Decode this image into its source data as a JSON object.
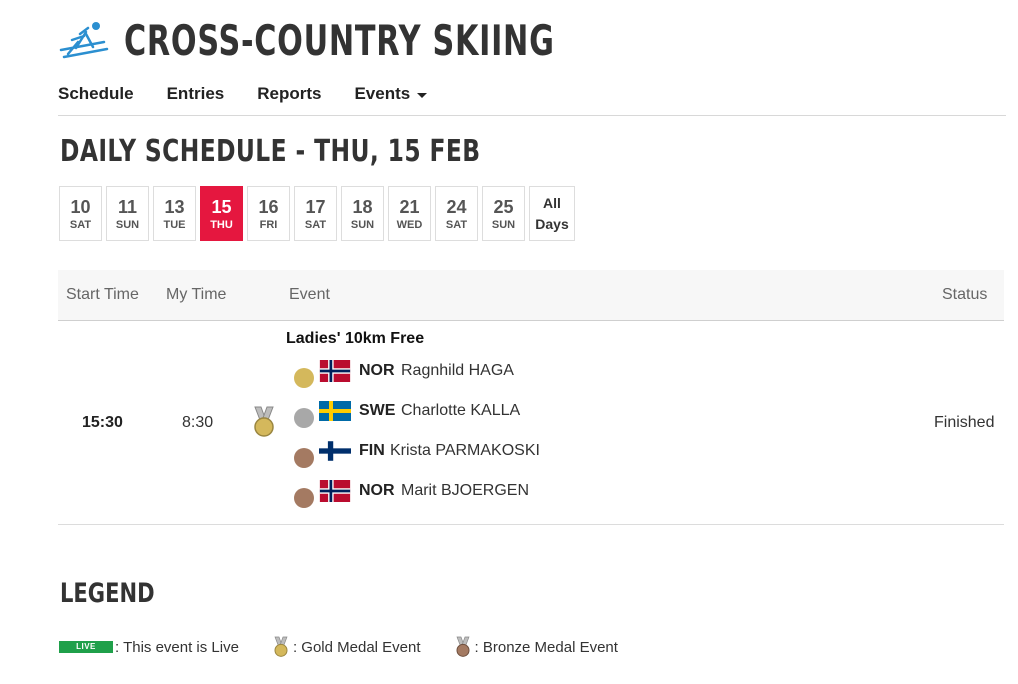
{
  "header": {
    "sport_title": "CROSS-COUNTRY SKIING",
    "logo_icon": "cross-country-skier-icon",
    "accent_color": "#e5173f"
  },
  "nav": {
    "items": [
      {
        "label": "Schedule"
      },
      {
        "label": "Entries"
      },
      {
        "label": "Reports"
      },
      {
        "label": "Events",
        "has_dropdown": true
      }
    ]
  },
  "page_title": "DAILY SCHEDULE - THU, 15 FEB",
  "days": [
    {
      "num": "10",
      "dow": "SAT",
      "active": false
    },
    {
      "num": "11",
      "dow": "SUN",
      "active": false
    },
    {
      "num": "13",
      "dow": "TUE",
      "active": false
    },
    {
      "num": "15",
      "dow": "THU",
      "active": true
    },
    {
      "num": "16",
      "dow": "FRI",
      "active": false
    },
    {
      "num": "17",
      "dow": "SAT",
      "active": false
    },
    {
      "num": "18",
      "dow": "SUN",
      "active": false
    },
    {
      "num": "21",
      "dow": "WED",
      "active": false
    },
    {
      "num": "24",
      "dow": "SAT",
      "active": false
    },
    {
      "num": "25",
      "dow": "SUN",
      "active": false
    }
  ],
  "all_days": {
    "line1": "All",
    "line2": "Days"
  },
  "table": {
    "headers": {
      "start_time": "Start Time",
      "my_time": "My Time",
      "event": "Event",
      "status": "Status"
    },
    "rows": [
      {
        "start_time": "15:30",
        "my_time": "8:30",
        "medal_event_icon": "gold-medal-icon",
        "event_name": "Ladies' 10km Free",
        "status": "Finished",
        "results": [
          {
            "medal": "gold",
            "medal_color": "#d4b85c",
            "flag": "norway-flag-icon",
            "noc": "NOR",
            "athlete": "Ragnhild HAGA"
          },
          {
            "medal": "silver",
            "medal_color": "#a8a8a8",
            "flag": "sweden-flag-icon",
            "noc": "SWE",
            "athlete": "Charlotte KALLA"
          },
          {
            "medal": "bronze",
            "medal_color": "#a47a62",
            "flag": "finland-flag-icon",
            "noc": "FIN",
            "athlete": "Krista PARMAKOSKI"
          },
          {
            "medal": "bronze",
            "medal_color": "#a47a62",
            "flag": "norway-flag-icon",
            "noc": "NOR",
            "athlete": "Marit BJOERGEN"
          }
        ]
      }
    ]
  },
  "legend": {
    "title": "LEGEND",
    "live_badge": "LIVE",
    "live_text": ": This event is Live",
    "gold_text": ": Gold Medal Event",
    "bronze_text": ": Bronze Medal Event"
  }
}
